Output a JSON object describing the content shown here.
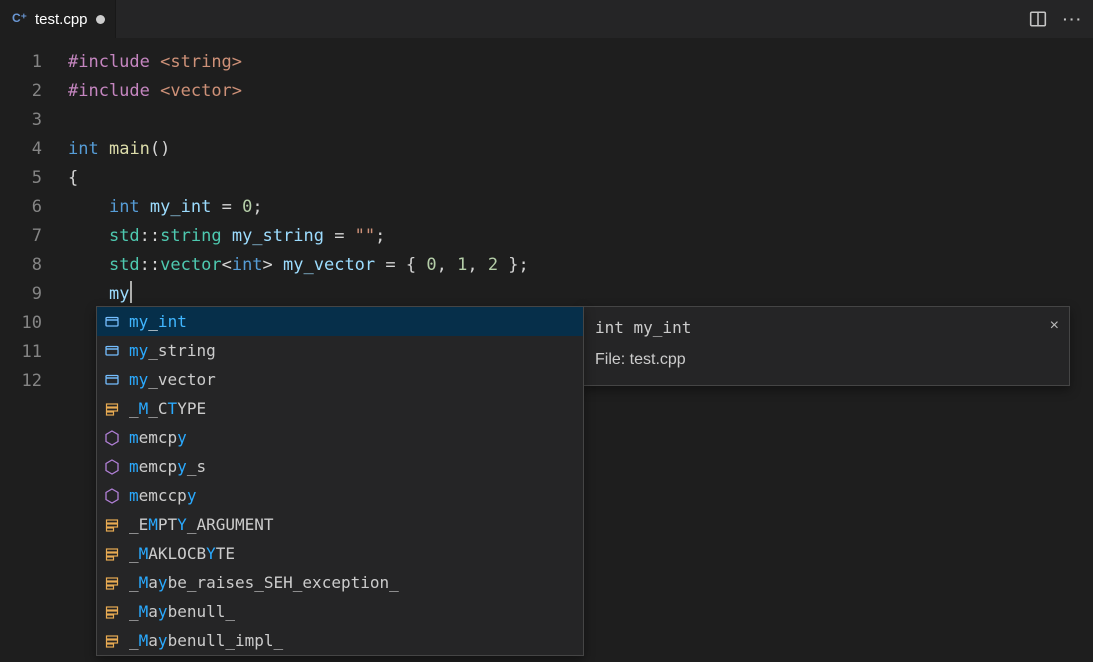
{
  "tab": {
    "filename": "test.cpp"
  },
  "code": {
    "lines": [
      {
        "n": 1,
        "tokens": [
          [
            "pp",
            "#include"
          ],
          [
            "op",
            " "
          ],
          [
            "inc",
            "<string>"
          ]
        ]
      },
      {
        "n": 2,
        "tokens": [
          [
            "pp",
            "#include"
          ],
          [
            "op",
            " "
          ],
          [
            "inc",
            "<vector>"
          ]
        ]
      },
      {
        "n": 3,
        "tokens": []
      },
      {
        "n": 4,
        "tokens": [
          [
            "kw",
            "int"
          ],
          [
            "op",
            " "
          ],
          [
            "fn",
            "main"
          ],
          [
            "pun",
            "()"
          ]
        ]
      },
      {
        "n": 5,
        "tokens": [
          [
            "pun",
            "{"
          ]
        ]
      },
      {
        "n": 6,
        "tokens": [
          [
            "op",
            "    "
          ],
          [
            "kw",
            "int"
          ],
          [
            "op",
            " "
          ],
          [
            "var",
            "my_int"
          ],
          [
            "op",
            " = "
          ],
          [
            "num",
            "0"
          ],
          [
            "pun",
            ";"
          ]
        ]
      },
      {
        "n": 7,
        "tokens": [
          [
            "op",
            "    "
          ],
          [
            "ns",
            "std"
          ],
          [
            "op",
            "::"
          ],
          [
            "type",
            "string"
          ],
          [
            "op",
            " "
          ],
          [
            "var",
            "my_string"
          ],
          [
            "op",
            " = "
          ],
          [
            "str",
            "\"\""
          ],
          [
            "pun",
            ";"
          ]
        ]
      },
      {
        "n": 8,
        "tokens": [
          [
            "op",
            "    "
          ],
          [
            "ns",
            "std"
          ],
          [
            "op",
            "::"
          ],
          [
            "type",
            "vector"
          ],
          [
            "op",
            "<"
          ],
          [
            "kw",
            "int"
          ],
          [
            "op",
            "> "
          ],
          [
            "var",
            "my_vector"
          ],
          [
            "op",
            " = { "
          ],
          [
            "num",
            "0"
          ],
          [
            "op",
            ", "
          ],
          [
            "num",
            "1"
          ],
          [
            "op",
            ", "
          ],
          [
            "num",
            "2"
          ],
          [
            "op",
            " }"
          ],
          [
            "pun",
            ";"
          ]
        ]
      },
      {
        "n": 9,
        "tokens": [
          [
            "op",
            "    "
          ],
          [
            "var",
            "my"
          ]
        ],
        "cursor": true
      },
      {
        "n": 10,
        "tokens": []
      },
      {
        "n": 11,
        "tokens": []
      },
      {
        "n": 12,
        "tokens": []
      }
    ]
  },
  "suggest": {
    "items": [
      {
        "icon": "variable",
        "label": "my_int",
        "match": [
          0,
          1,
          3,
          4,
          5
        ],
        "selected": true
      },
      {
        "icon": "variable",
        "label": "my_string",
        "match": [
          0,
          1
        ]
      },
      {
        "icon": "variable",
        "label": "my_vector",
        "match": [
          0,
          1
        ]
      },
      {
        "icon": "constant",
        "label": "_M_CTYPE",
        "match": [
          1,
          4
        ]
      },
      {
        "icon": "function",
        "label": "memcpy",
        "match": [
          0,
          5
        ]
      },
      {
        "icon": "function",
        "label": "memcpy_s",
        "match": [
          0,
          5
        ]
      },
      {
        "icon": "function",
        "label": "memccpy",
        "match": [
          0,
          6
        ]
      },
      {
        "icon": "constant",
        "label": "_EMPTY_ARGUMENT",
        "match": [
          2,
          5
        ]
      },
      {
        "icon": "constant",
        "label": "_MAKLOCBYTE",
        "match": [
          1,
          8
        ]
      },
      {
        "icon": "constant",
        "label": "_Maybe_raises_SEH_exception_",
        "match": [
          1,
          3
        ]
      },
      {
        "icon": "constant",
        "label": "_Maybenull_",
        "match": [
          1,
          3
        ]
      },
      {
        "icon": "constant",
        "label": "_Maybenull_impl_",
        "match": [
          1,
          3
        ]
      }
    ]
  },
  "detail": {
    "signature": "int my_int",
    "file_label": "File: test.cpp"
  }
}
